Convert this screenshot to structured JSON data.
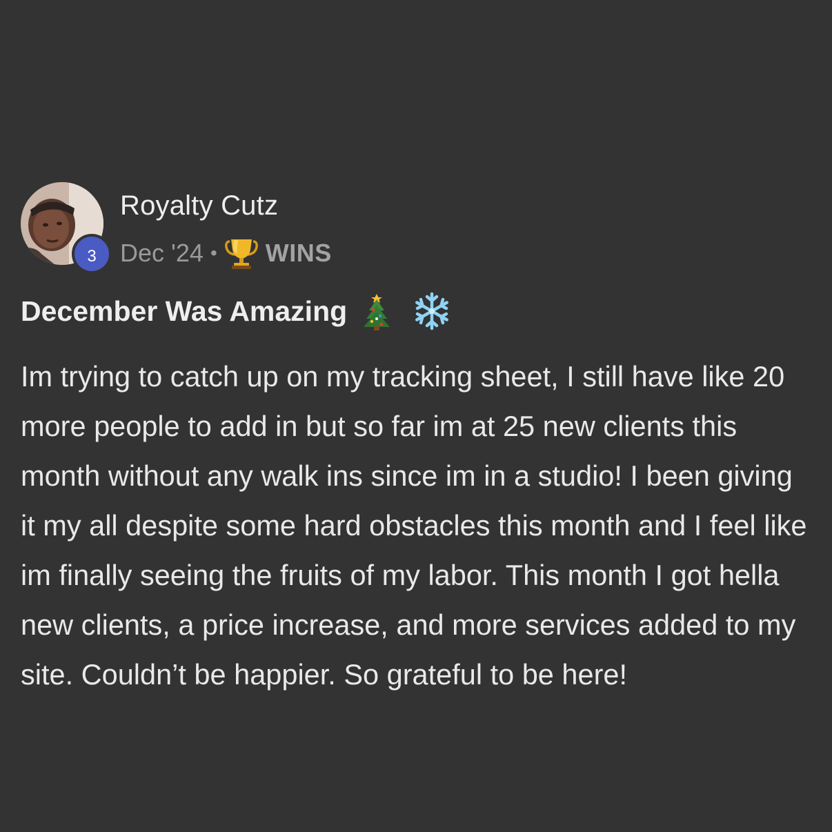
{
  "post": {
    "author": {
      "name": "Royalty Cutz",
      "level": "3"
    },
    "meta": {
      "date": "Dec '24",
      "separator": "•",
      "category_icon": "trophy-icon",
      "category": "WINS"
    },
    "title": "December Was Amazing",
    "title_icons": [
      "christmas-tree-icon",
      "snowflake-icon"
    ],
    "body": "Im trying to catch up on my tracking sheet, I still have like 20 more people to add in but so far im at 25 new clients this month without any walk ins since im in a studio! I been giving it my all despite some hard obstacles this month and I feel like im finally seeing the fruits of my labor. This month I got hella new clients, a price increase, and more services added to my site. Couldn’t be happier. So grateful to be here!"
  },
  "colors": {
    "background": "#333333",
    "text": "#e9e9e9",
    "meta_text": "#9a9a9a",
    "level_badge": "#4a5bc4"
  }
}
